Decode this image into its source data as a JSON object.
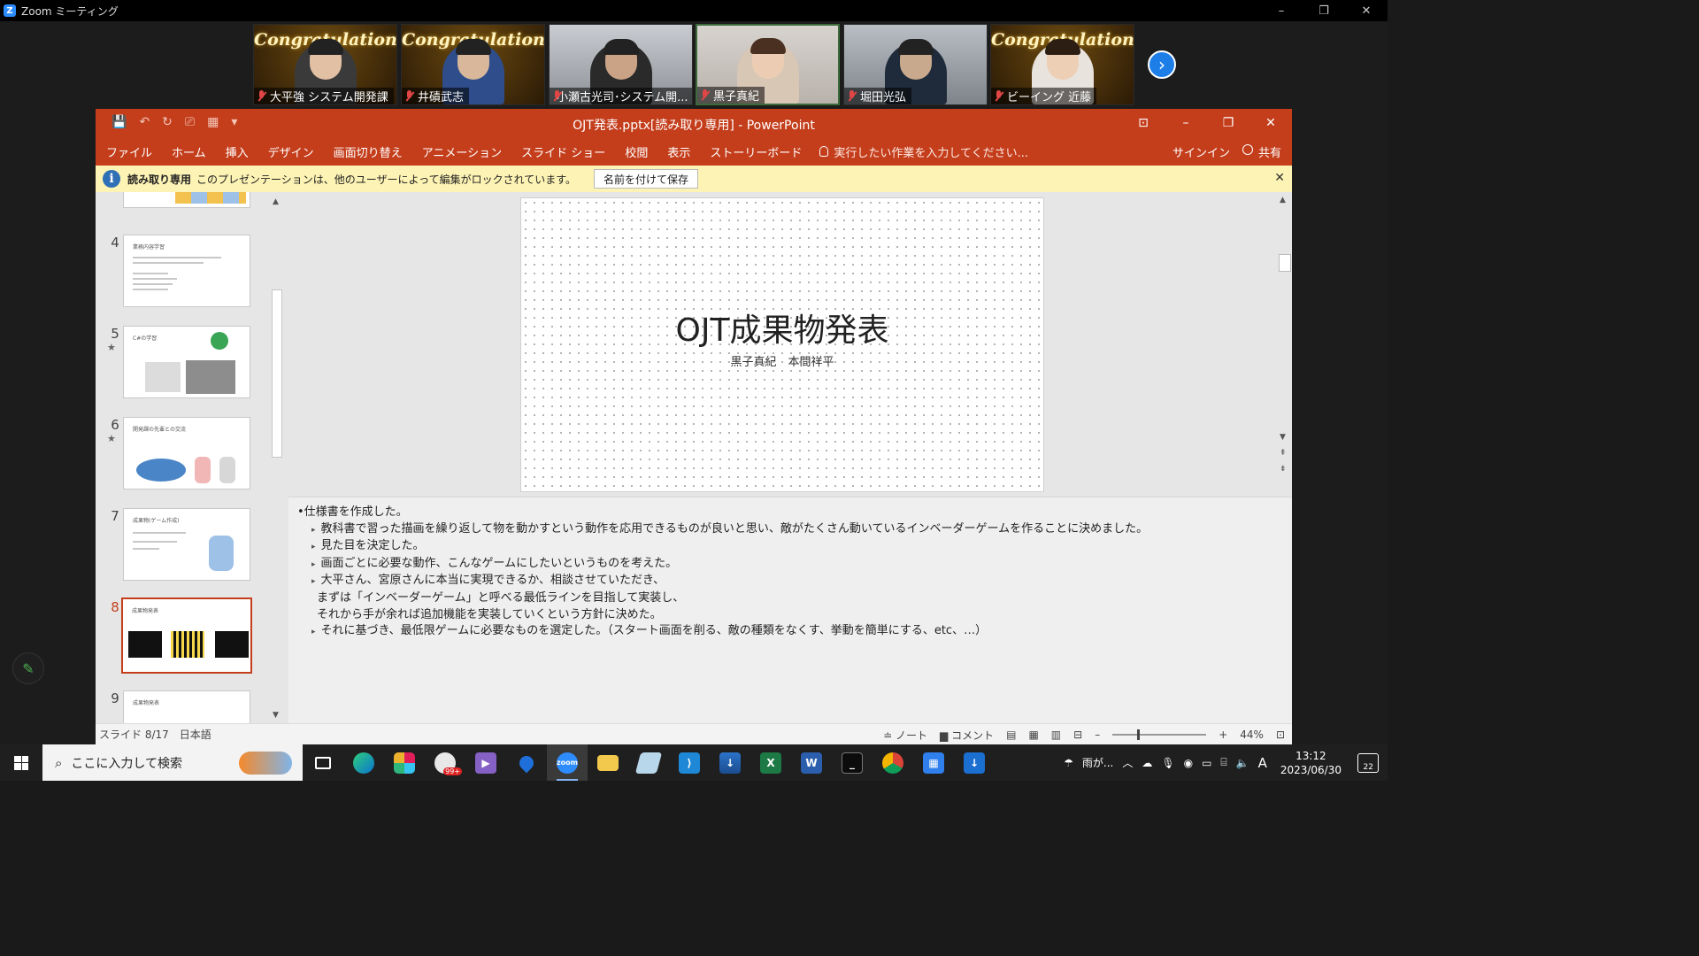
{
  "zoom": {
    "title": "Zoom ミーティング",
    "window_controls": [
      "–",
      "❐",
      "✕"
    ],
    "participants": [
      {
        "name": "大平強 システム開発課",
        "banner": "Congratulations!",
        "muted": true
      },
      {
        "name": "井磧武志",
        "banner": "Congratulations!",
        "muted": true
      },
      {
        "name": "小瀬古光司･システム開...",
        "banner": "",
        "muted": true
      },
      {
        "name": "黒子真紀",
        "banner": "",
        "muted": true
      },
      {
        "name": "堀田光弘",
        "banner": "",
        "muted": true
      },
      {
        "name": "ビーイング 近藤",
        "banner": "Congratulations!",
        "muted": true
      }
    ],
    "next_label": "›"
  },
  "ppt": {
    "doc_title": "OJT発表.pptx[読み取り専用] - PowerPoint",
    "qat": [
      "💾",
      "↶",
      "↻",
      "⎚",
      "▦",
      "▾"
    ],
    "window_controls": [
      "⊡",
      "–",
      "❐",
      "✕"
    ],
    "tabs": [
      "ファイル",
      "ホーム",
      "挿入",
      "デザイン",
      "画面切り替え",
      "アニメーション",
      "スライド ショー",
      "校閲",
      "表示",
      "ストーリーボード"
    ],
    "tell_me": "実行したい作業を入力してください...",
    "signin": "サインイン",
    "share": "共有",
    "infobar": {
      "label": "読み取り専用",
      "message": "このプレゼンテーションは、他のユーザーによって編集がロックされています。",
      "button": "名前を付けて保存",
      "close": "✕"
    },
    "thumbnails": [
      {
        "num": "4",
        "star": false,
        "title": "業務内容学習"
      },
      {
        "num": "5",
        "star": true,
        "title": "C#の学習"
      },
      {
        "num": "6",
        "star": true,
        "title": "開発課の先輩との交流"
      },
      {
        "num": "7",
        "star": false,
        "title": "成果物(ゲーム作成)"
      },
      {
        "num": "8",
        "star": false,
        "title": "成果物発表"
      },
      {
        "num": "9",
        "star": false,
        "title": "成果物発表"
      }
    ],
    "slide": {
      "title": "OJT成果物発表",
      "subtitle": "黒子真紀　本間祥平"
    },
    "notes": {
      "heading": "仕様書を作成した。",
      "items": [
        "教科書で習った描画を繰り返して物を動かすという動作を応用できるものが良いと思い、敵がたくさん動いているインベーダーゲームを作ることに決めました。",
        "見た目を決定した。",
        "画面ごとに必要な動作、こんなゲームにしたいというものを考えた。",
        "大平さん、宮原さんに本当に実現できるか、相談させていただき、",
        "それに基づき、最低限ゲームに必要なものを選定した。（スタート画面を削る、敵の種類をなくす、挙動を簡単にする、etc、…）"
      ],
      "continuation": [
        "まずは「インベーダーゲーム」と呼べる最低ラインを目指して実装し、",
        "それから手が余れば追加機能を実装していくという方針に決めた。"
      ]
    },
    "status": {
      "slide_info": "スライド 8/17",
      "language": "日本語",
      "notes_btn": "ノート",
      "comments_btn": "コメント",
      "zoom": "44%"
    }
  },
  "taskbar": {
    "search_placeholder": "ここに入力して検索",
    "weather": "雨が...",
    "ime": "A",
    "time": "13:12",
    "date": "2023/06/30",
    "notif_count": "22",
    "badge": "99+"
  },
  "colors": {
    "ppt_accent": "#c43e1c",
    "zoom_blue": "#2d8cff",
    "infobar": "#fdf3b4"
  }
}
